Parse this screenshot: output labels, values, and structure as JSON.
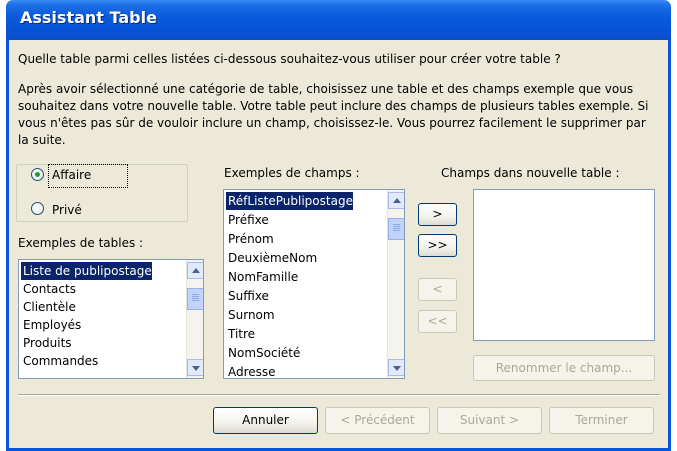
{
  "window": {
    "title": "Assistant Table"
  },
  "question": "Quelle table parmi celles listées ci-dessous souhaitez-vous utiliser pour créer votre table ?",
  "instructions": "Après avoir sélectionné une catégorie de table, choisissez une table et des champs exemple que vous souhaitez dans votre nouvelle table. Votre table peut inclure des champs de plusieurs tables exemple. Si vous n'êtes pas sûr de vouloir inclure un champ, choisissez-le. Vous pourrez facilement le supprimer par la suite.",
  "category": {
    "options": [
      {
        "label": "Affaire",
        "selected": true
      },
      {
        "label": "Privé",
        "selected": false
      }
    ]
  },
  "tables": {
    "label": "Exemples de tables :",
    "items": [
      "Liste de publipostage",
      "Contacts",
      "Clientèle",
      "Employés",
      "Produits",
      "Commandes"
    ],
    "selected_index": 0
  },
  "fields": {
    "label": "Exemples de champs :",
    "items": [
      "RéfListePublipostage",
      "Préfixe",
      "Prénom",
      "DeuxièmeNom",
      "NomFamille",
      "Suffixe",
      "Surnom",
      "Titre",
      "NomSociété",
      "Adresse"
    ],
    "selected_index": 0
  },
  "new_fields": {
    "label": "Champs dans nouvelle table :",
    "items": []
  },
  "move_buttons": {
    "add_one": ">",
    "add_all": ">>",
    "remove_one": "<",
    "remove_all": "<<"
  },
  "rename_button": "Renommer le champ...",
  "footer": {
    "cancel": "Annuler",
    "back": "< Précédent",
    "next": "Suivant >",
    "finish": "Terminer"
  },
  "colors": {
    "title_bar": "#0a5adc",
    "dialog_bg": "#ece9d8",
    "selection": "#0a246a",
    "button_border": "#003c74",
    "disabled_text": "#aca899"
  }
}
